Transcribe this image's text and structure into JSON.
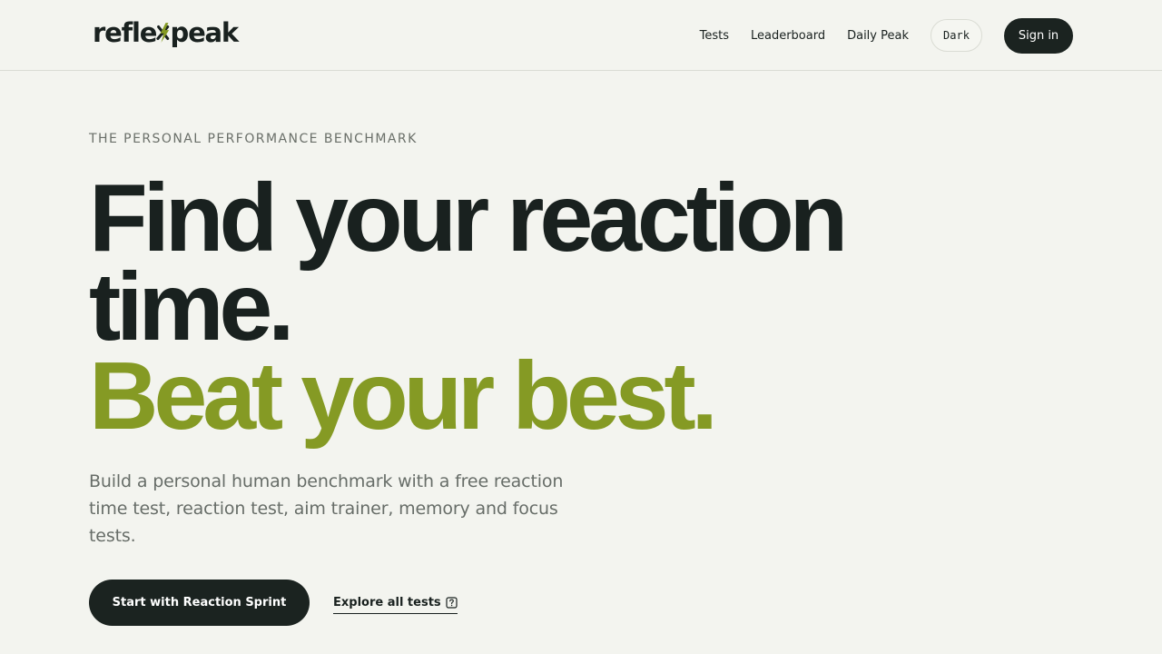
{
  "brand": {
    "name_left": "refle",
    "name_right": "peak",
    "logo_mark_icon": "lightning-x-mark",
    "primary_color": "#19211f",
    "accent_color": "#859a24"
  },
  "header": {
    "nav": [
      {
        "label": "Tests"
      },
      {
        "label": "Leaderboard"
      },
      {
        "label": "Daily Peak"
      }
    ],
    "theme_button": "Dark",
    "sign_in": "Sign in"
  },
  "hero": {
    "eyebrow": "THE PERSONAL PERFORMANCE BENCHMARK",
    "headline_line_1": "Find your reaction",
    "headline_line_2": "time.",
    "headline_line_3": "Beat your best.",
    "description": "Build a personal human benchmark with a free reaction time test, reaction test, aim trainer, memory and focus tests.",
    "primary_cta": "Start with Reaction Sprint",
    "secondary_cta": "Explore all tests",
    "secondary_cta_icon": "help-icon"
  }
}
